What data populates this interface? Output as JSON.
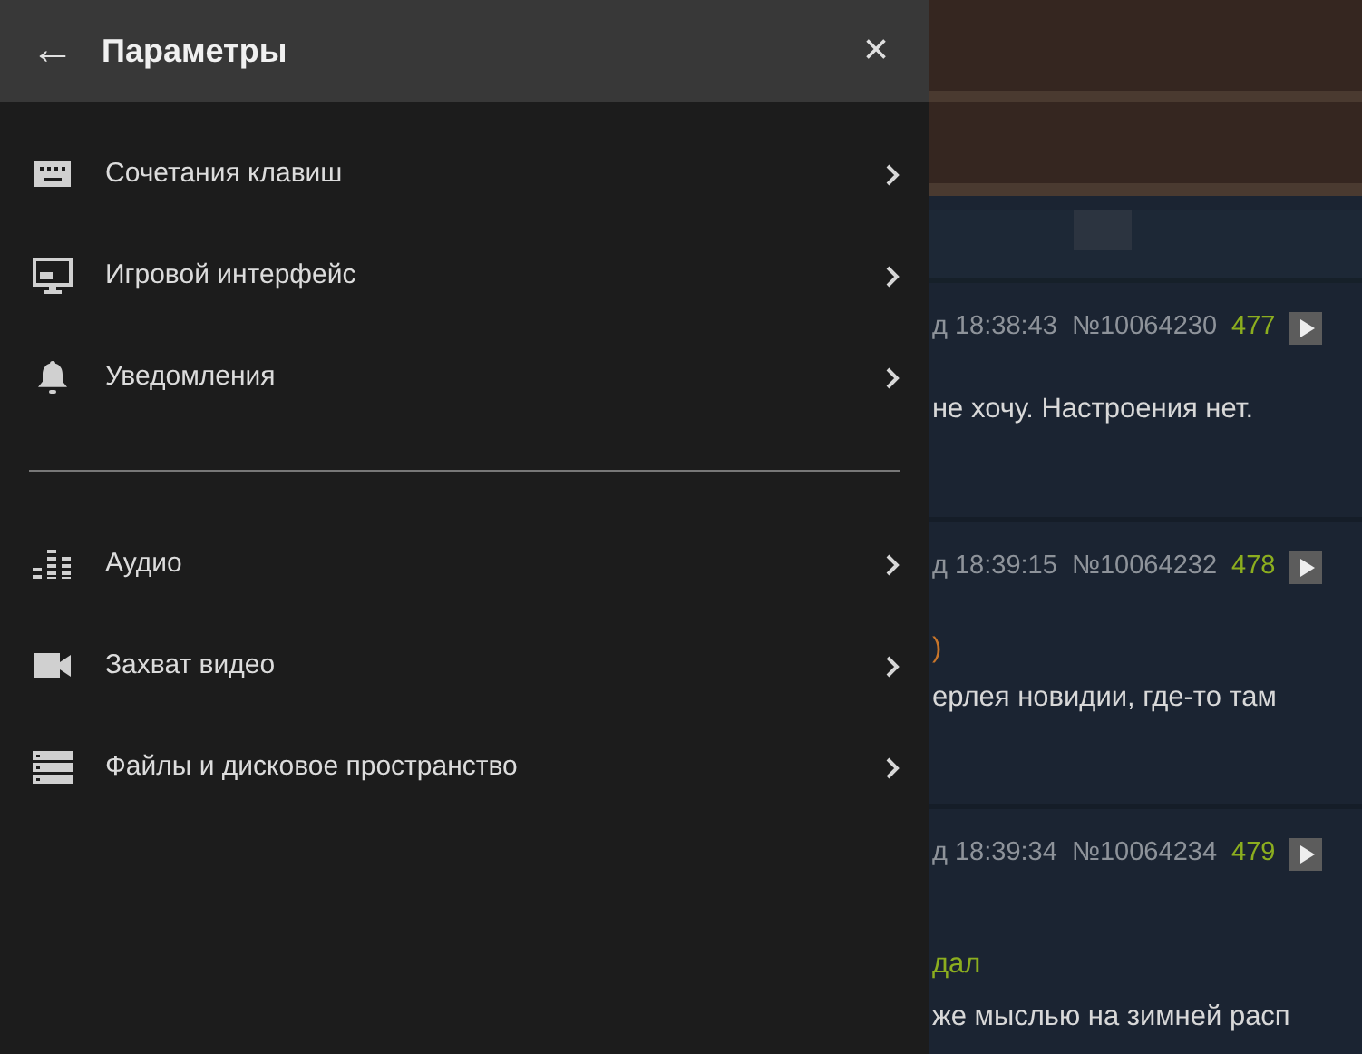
{
  "panel": {
    "title": "Параметры",
    "back_icon": "←",
    "close_icon": "×",
    "groups": [
      [
        {
          "label": "Сочетания клавиш"
        },
        {
          "label": "Игровой интерфейс"
        },
        {
          "label": "Уведомления"
        }
      ],
      [
        {
          "label": "Аудио"
        },
        {
          "label": "Захват видео"
        },
        {
          "label": "Файлы и дисковое пространство"
        }
      ]
    ]
  },
  "posts": [
    {
      "time": "д 18:38:43",
      "number": "№10064230",
      "count": "477",
      "lines": [
        {
          "kind": "text",
          "text": "не хочу. Настроения нет."
        }
      ]
    },
    {
      "time": "д 18:39:15",
      "number": "№10064232",
      "count": "478",
      "lines": [
        {
          "kind": "accent",
          "text": ")"
        },
        {
          "kind": "text",
          "text": "ерлея новидии, где-то там"
        }
      ]
    },
    {
      "time": "д 18:39:34",
      "number": "№10064234",
      "count": "479",
      "lines": [
        {
          "kind": "quote",
          "text": "дал"
        },
        {
          "kind": "text",
          "text": "же мыслью на зимней расп"
        }
      ]
    }
  ]
}
